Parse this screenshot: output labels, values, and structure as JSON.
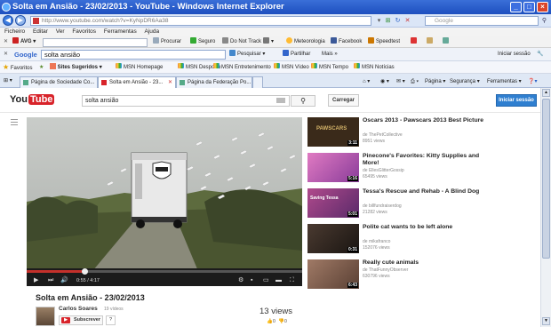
{
  "window": {
    "title": "Solta em Ansião - 23/02/2013 - YouTube - Windows Internet Explorer",
    "controls": [
      "_",
      "□",
      "×"
    ]
  },
  "address_bar": {
    "url": "http://www.youtube.com/watch?v=KyNpDR6Aa38",
    "search_placeholder": "Google"
  },
  "menu": [
    "Ficheiro",
    "Editar",
    "Ver",
    "Favoritos",
    "Ferramentas",
    "Ajuda"
  ],
  "avg_toolbar": {
    "brand": "AVG",
    "search": "Procurar",
    "items": [
      "Seguro",
      "Do Not Track",
      "Meteorologia",
      "Facebook",
      "Speedtest"
    ]
  },
  "google_toolbar": {
    "brand": "Google",
    "query": "solta ansião",
    "search_btn": "Pesquisar",
    "share_btn": "Partilhar",
    "more_btn": "Mais »",
    "signin": "Iniciar sessão"
  },
  "favorites": {
    "label": "Favoritos",
    "suggested": "Sites Sugeridos",
    "links": [
      "MSN Homepage",
      "MSN Desporto",
      "MSN Entretenimento",
      "MSN Vídeo",
      "MSN Tempo",
      "MSN Notícias"
    ]
  },
  "tabs": [
    {
      "label": "Página de Sociedade Co..."
    },
    {
      "label": "Solta em Ansião - 23..."
    },
    {
      "label": "Página da Federação Po..."
    }
  ],
  "commandbar": {
    "page": "Página",
    "safety": "Segurança",
    "tools": "Ferramentas"
  },
  "youtube": {
    "logo_you": "You",
    "logo_tube": "Tube",
    "search_value": "solta ansião",
    "upload": "Carregar",
    "signin": "Iniciar sessão"
  },
  "player": {
    "time": "0:55 / 4:17",
    "progress": 0.21
  },
  "video": {
    "title": "Solta em Ansião - 23/02/2013",
    "channel": "Carlos Soares",
    "channel_videos": "19 vídeos",
    "subscribe": "Subscrever",
    "subscriber_count": "?",
    "views": "13 views",
    "likes": "0",
    "dislikes": "0"
  },
  "related": [
    {
      "title": "Oscars 2013 - Pawscars 2013 Best Picture",
      "by": "de ThePetCollective",
      "views": "8951 views",
      "duration": "3:11",
      "thumb_color": "#3a2a1a",
      "thumb_text": "PAWSCARS"
    },
    {
      "title": "Pinecone's Favorites: Kitty Supplies and More!",
      "by": "de EllesGlitterGossip",
      "views": "65495 views",
      "duration": "5:16",
      "thumb_color": "#c85aa8",
      "thumb_text": ""
    },
    {
      "title": "Tessa's Rescue and Rehab - A Blind Dog",
      "by": "de billfundraiserdog",
      "views": "21282 views",
      "duration": "5:01",
      "thumb_color": "#8a3b7a",
      "thumb_text": "Saving Tessa"
    },
    {
      "title": "Polite cat wants to be left alone",
      "by": "de mikafranco",
      "views": "152076 views",
      "duration": "0:31",
      "thumb_color": "#2b2520",
      "thumb_text": ""
    },
    {
      "title": "Really cute animals",
      "by": "de ThatFunnyObserver",
      "views": "630796 views",
      "duration": "6:43",
      "thumb_color": "#7a5a4a",
      "thumb_text": ""
    }
  ]
}
